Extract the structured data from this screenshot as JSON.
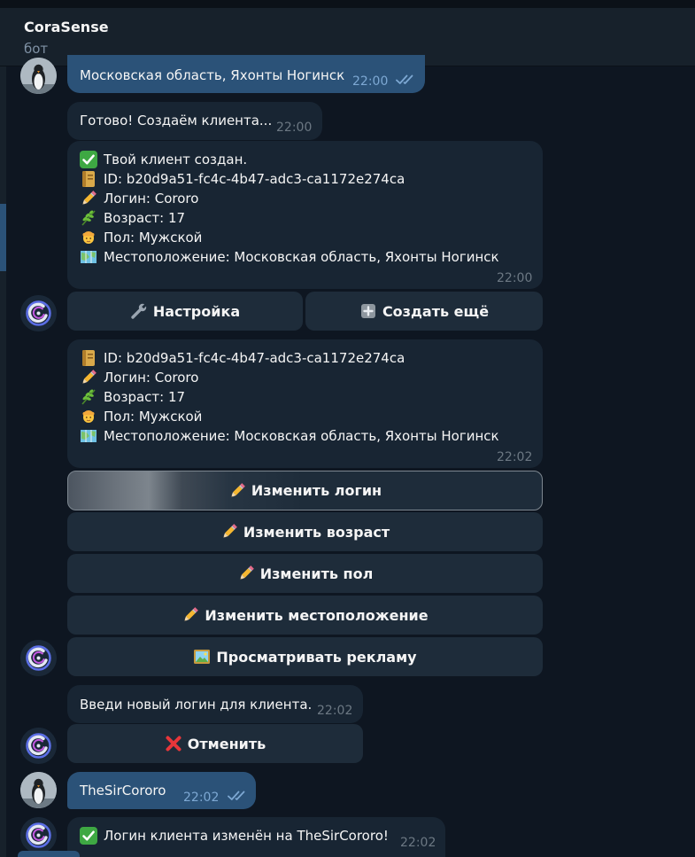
{
  "header": {
    "title": "CoraSense",
    "subtitle": "бот"
  },
  "colors": {
    "background": "#0e1621",
    "incoming": "#182533",
    "outgoing": "#2b5278",
    "button": "#1e2c3a",
    "meta": "#6c7883",
    "read_checks": "#7da8d3"
  },
  "messages": {
    "m1": {
      "text": "Московская область, Яхонты Ногинск",
      "time": "22:00",
      "status": "read"
    },
    "m2": {
      "text": "Готово! Создаём клиента...",
      "time": "22:00"
    },
    "m3": {
      "lines": [
        {
          "icon": "check-mark-icon",
          "text": "Твой клиент создан."
        },
        {
          "icon": "id-card-icon",
          "text": "ID: b20d9a51-fc4c-4b47-adc3-ca1172e274ca"
        },
        {
          "icon": "pencil-icon",
          "text": "Логин: Cororo"
        },
        {
          "icon": "herb-icon",
          "text": "Возраст: 17"
        },
        {
          "icon": "person-icon",
          "text": "Пол: Мужской"
        },
        {
          "icon": "map-icon",
          "text": "Местоположение: Московская область, Яхонты Ногинск"
        }
      ],
      "time": "22:00"
    },
    "kb1": {
      "settings": "Настройка",
      "create_more": "Создать ещё"
    },
    "m4": {
      "lines": [
        {
          "icon": "id-card-icon",
          "text": "ID: b20d9a51-fc4c-4b47-adc3-ca1172e274ca"
        },
        {
          "icon": "pencil-icon",
          "text": "Логин: Cororo"
        },
        {
          "icon": "herb-icon",
          "text": "Возраст: 17"
        },
        {
          "icon": "person-icon",
          "text": "Пол: Мужской"
        },
        {
          "icon": "map-icon",
          "text": "Местоположение: Московская область, Яхонты Ногинск"
        }
      ],
      "time": "22:02"
    },
    "kb2": {
      "change_login": "Изменить логин",
      "change_age": "Изменить возраст",
      "change_gender": "Изменить пол",
      "change_location": "Изменить местоположение",
      "watch_ads": "Просматривать рекламу"
    },
    "m5": {
      "text": "Введи новый логин для клиента.",
      "time": "22:02"
    },
    "kb3": {
      "cancel": "Отменить"
    },
    "m6": {
      "text": "TheSirCororo",
      "time": "22:02",
      "status": "read"
    },
    "m7": {
      "text": "Логин клиента изменён на TheSirCororo!",
      "time": "22:02"
    }
  }
}
